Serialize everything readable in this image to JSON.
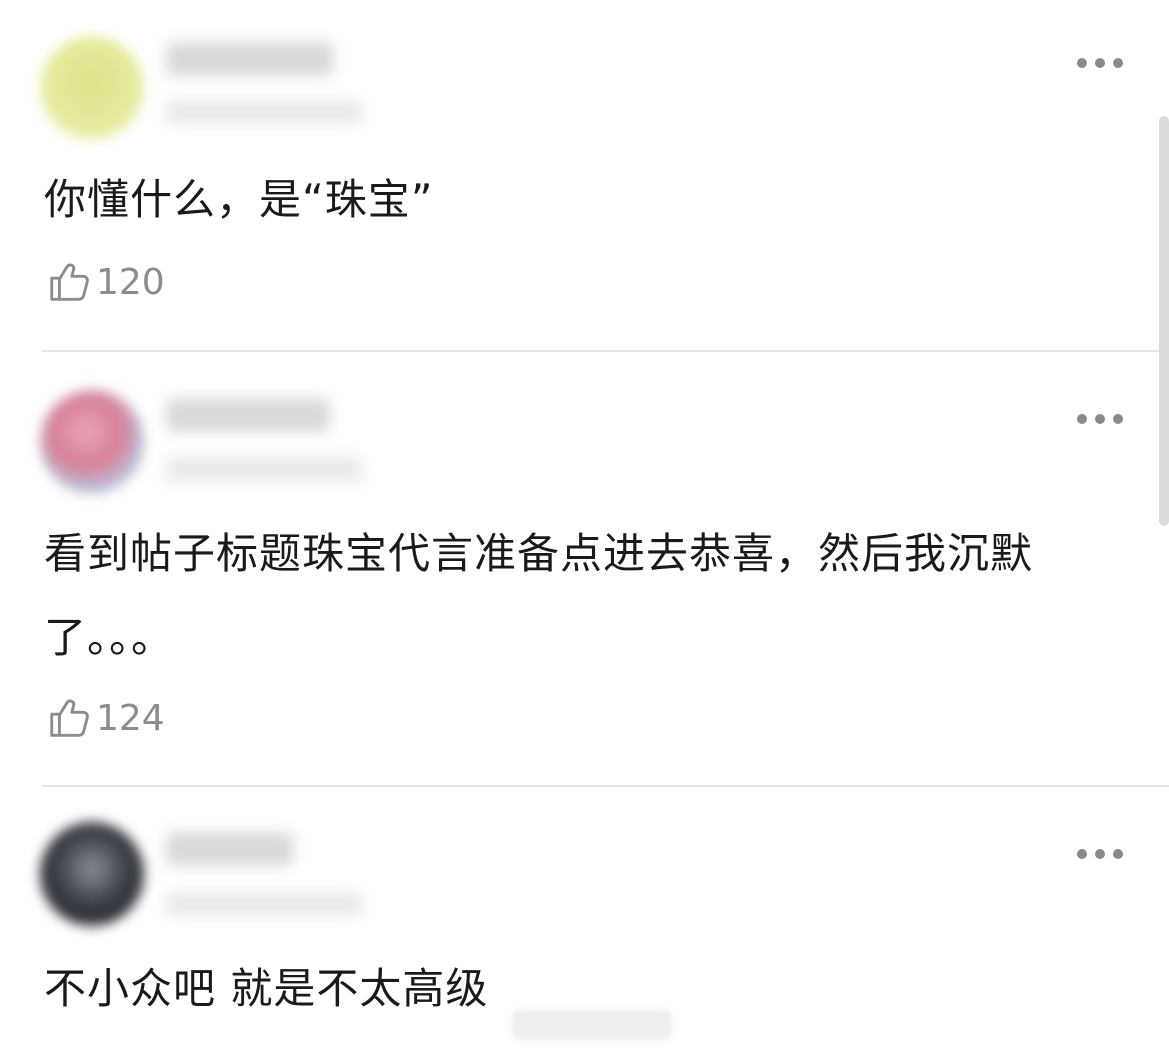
{
  "comments": [
    {
      "username": "",
      "meta": "",
      "text": "你懂什么，是“珠宝”",
      "likes": "120"
    },
    {
      "username": "",
      "meta": "",
      "text": "看到帖子标题珠宝代言准备点进去恭喜，然后我沉默了。。。",
      "likes": "124"
    },
    {
      "username": "",
      "meta": "",
      "text": "不小众吧 就是不太高级"
    }
  ],
  "icons": {
    "more": "more-options-icon",
    "like": "thumbs-up-icon"
  },
  "colors": {
    "text": "#1a1a1a",
    "secondary": "#8c8c8c",
    "divider": "#e6e6e6",
    "background": "#ffffff"
  }
}
